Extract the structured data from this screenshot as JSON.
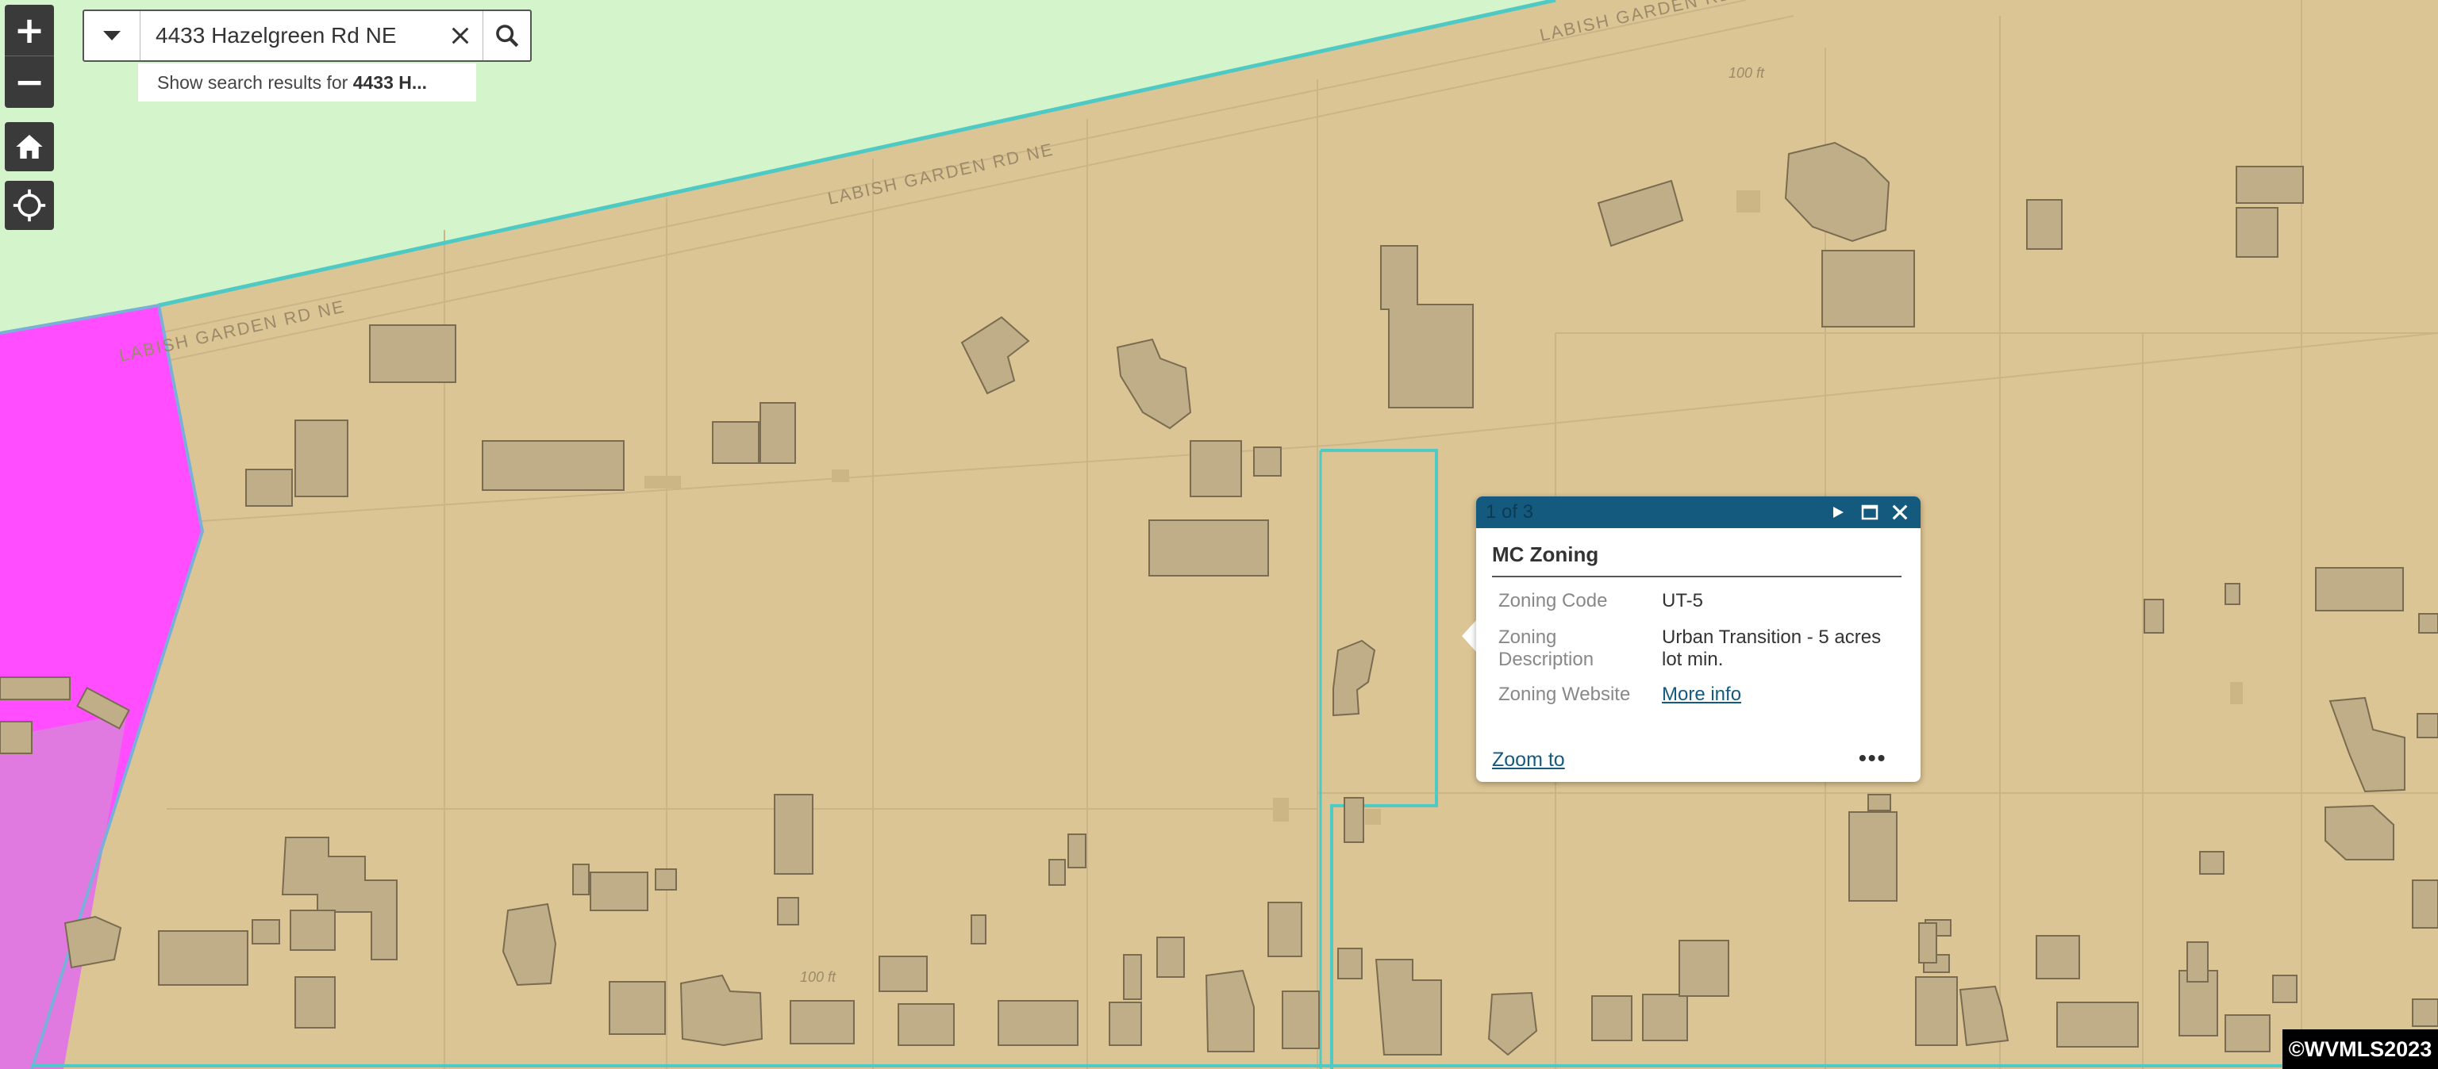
{
  "search": {
    "value": "4433 Hazelgreen Rd NE",
    "suggestion_prefix": "Show search results for ",
    "suggestion_bold": "4433 H..."
  },
  "controls": {
    "zoom_in_label": "+",
    "zoom_out_label": "−"
  },
  "map": {
    "road_labels": [
      "LABISH GARDEN RD NE",
      "LABISH GARDEN RD NE",
      "LABISH GARDEN RD NE",
      "100 ft",
      "100 ft"
    ],
    "colors": {
      "zone_main": "#dcc595",
      "zone_green": "#d4f5cc",
      "zone_magenta": "#ff4dff",
      "zone_boundary": "#4fc9c4",
      "building_fill": "#bfae88",
      "building_stroke": "#7a6c50"
    }
  },
  "popup": {
    "paging": "1 of 3",
    "title": "MC Zoning",
    "fields": [
      {
        "label": "Zoning Code",
        "value": "UT-5"
      },
      {
        "label": "Zoning Description",
        "value": "Urban Transition - 5 acres lot min."
      },
      {
        "label": "Zoning Website",
        "value": "More info"
      }
    ],
    "zoom_to": "Zoom to",
    "more": "•••"
  },
  "copyright": "©WVMLS2023",
  "icons": [
    "dropdown-caret-icon",
    "clear-icon",
    "search-icon",
    "home-icon",
    "locate-icon",
    "next-icon",
    "maximize-icon",
    "close-icon"
  ]
}
